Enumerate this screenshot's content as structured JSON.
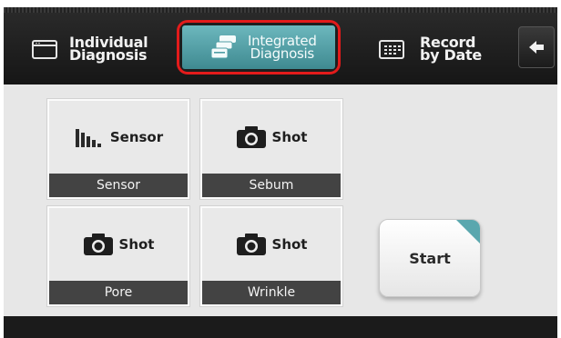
{
  "tabs": {
    "individual": "Individual\nDiagnosis",
    "integrated": "Integrated\nDiagnosis",
    "record": "Record\nby Date"
  },
  "tiles": [
    {
      "caption": "Sensor",
      "footer": "Sensor",
      "icon": "sensor-bars-icon"
    },
    {
      "caption": "Shot",
      "footer": "Sebum",
      "icon": "camera-icon"
    },
    {
      "caption": "Shot",
      "footer": "Pore",
      "icon": "camera-icon"
    },
    {
      "caption": "Shot",
      "footer": "Wrinkle",
      "icon": "camera-icon"
    }
  ],
  "start_label": "Start",
  "colors": {
    "accent": "#4f9ea5",
    "highlight_border": "#e31b1b",
    "tile_footer": "#434343"
  }
}
